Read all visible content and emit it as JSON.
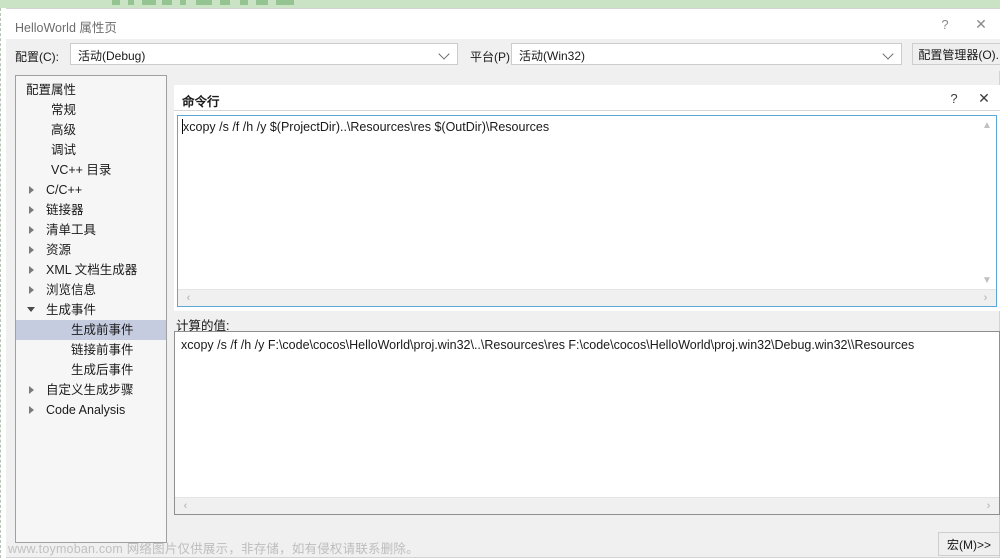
{
  "window": {
    "title": "HelloWorld 属性页",
    "help_icon": "?",
    "close_icon": "✕"
  },
  "config_row": {
    "configuration_label": "配置(C):",
    "configuration_value": "活动(Debug)",
    "platform_label": "平台(P):",
    "platform_value": "活动(Win32)",
    "config_manager_button": "配置管理器(O)..."
  },
  "tree": {
    "items": [
      {
        "label": "配置属性",
        "indent": 10,
        "twisty": "expanded",
        "selected": false
      },
      {
        "label": "常规",
        "indent": 35,
        "twisty": "none",
        "selected": false
      },
      {
        "label": "高级",
        "indent": 35,
        "twisty": "none",
        "selected": false
      },
      {
        "label": "调试",
        "indent": 35,
        "twisty": "none",
        "selected": false
      },
      {
        "label": "VC++ 目录",
        "indent": 35,
        "twisty": "none",
        "selected": false
      },
      {
        "label": "C/C++",
        "indent": 30,
        "twisty": "collapsed",
        "selected": false
      },
      {
        "label": "链接器",
        "indent": 30,
        "twisty": "collapsed",
        "selected": false
      },
      {
        "label": "清单工具",
        "indent": 30,
        "twisty": "collapsed",
        "selected": false
      },
      {
        "label": "资源",
        "indent": 30,
        "twisty": "collapsed",
        "selected": false
      },
      {
        "label": "XML 文档生成器",
        "indent": 30,
        "twisty": "collapsed",
        "selected": false
      },
      {
        "label": "浏览信息",
        "indent": 30,
        "twisty": "collapsed",
        "selected": false
      },
      {
        "label": "生成事件",
        "indent": 30,
        "twisty": "expanded",
        "selected": false
      },
      {
        "label": "生成前事件",
        "indent": 55,
        "twisty": "none",
        "selected": true
      },
      {
        "label": "链接前事件",
        "indent": 55,
        "twisty": "none",
        "selected": false
      },
      {
        "label": "生成后事件",
        "indent": 55,
        "twisty": "none",
        "selected": false
      },
      {
        "label": "自定义生成步骤",
        "indent": 30,
        "twisty": "collapsed",
        "selected": false
      },
      {
        "label": "Code Analysis",
        "indent": 30,
        "twisty": "collapsed",
        "selected": false
      }
    ]
  },
  "command_pane": {
    "title": "命令行",
    "help_icon": "?",
    "close_icon": "✕",
    "value": "xcopy /s /f /h /y $(ProjectDir)..\\Resources\\res $(OutDir)\\Resources",
    "scroll_left_icon": "‹",
    "scroll_right_icon": "›",
    "scroll_up_icon": "▲",
    "scroll_down_icon": "▼"
  },
  "evaluated": {
    "label": "计算的值:",
    "value": "xcopy /s /f /h /y F:\\code\\cocos\\HelloWorld\\proj.win32\\..\\Resources\\res F:\\code\\cocos\\HelloWorld\\proj.win32\\Debug.win32\\\\Resources",
    "scroll_left_icon": "‹",
    "scroll_right_icon": "›"
  },
  "footer": {
    "macro_button": "宏(M)>>"
  },
  "watermark": {
    "site": "www.toymoban.com",
    "notice": "网络图片仅供展示，非存储，如有侵权请联系删除。"
  },
  "colors": {
    "selection": "#c6cce0",
    "focus_border": "#5ba7d8",
    "dialog_bg": "#f0f0f0",
    "top_strip": "#c9e3c4"
  }
}
